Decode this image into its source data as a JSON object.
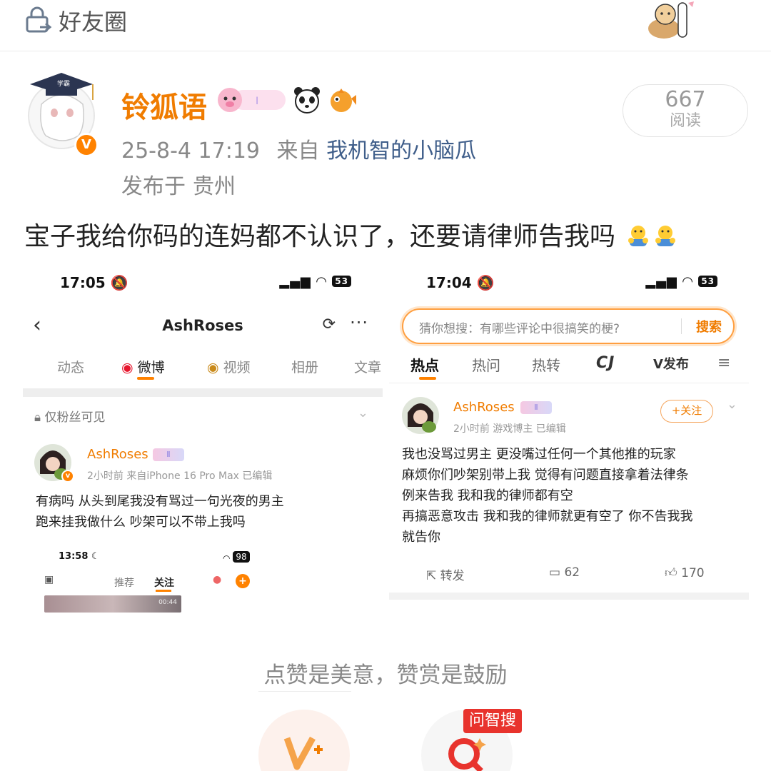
{
  "topbar": {
    "title": "好友圈"
  },
  "post": {
    "author": "铃狐语",
    "verified": "V",
    "date": "25-8-4 17:19",
    "from_prefix": "来自",
    "source": "我机智的小脑瓜",
    "published_prefix": "发布于",
    "location": "贵州",
    "reads": {
      "count": "667",
      "label": "阅读"
    },
    "text": "宝子我给你码的连妈都不认识了，还要请律师告我吗"
  },
  "shot_left": {
    "time": "17:05",
    "battery": "53",
    "title": "AshRoses",
    "tabs": [
      "动态",
      "微博",
      "视频",
      "相册",
      "文章"
    ],
    "visibility": "仅粉丝可见",
    "user": "AshRoses",
    "meta": "2小时前  来自iPhone 16 Pro Max  已编辑",
    "lines": [
      "有病吗 从头到尾我没有骂过一句光夜的男主",
      "跑来挂我做什么 吵架可以不带上我吗"
    ],
    "mini": {
      "time": "13:58",
      "battery": "98",
      "tab1": "推荐",
      "tab2": "关注",
      "plus": "+",
      "duration": "00:44"
    }
  },
  "shot_right": {
    "time": "17:04",
    "battery": "53",
    "search_placeholder": "猜你想搜：有哪些评论中很搞笑的梗?",
    "search_button": "搜索",
    "tabs": [
      "热点",
      "热问",
      "热转",
      "CJ",
      "V发布"
    ],
    "menu": "≡",
    "user": "AshRoses",
    "meta": "2小时前  游戏博主  已编辑",
    "follow": "+关注",
    "lines": [
      "我也没骂过男主 更没嘴过任何一个其他推的玩家",
      "麻烦你们吵架别带上我 觉得有问题直接拿着法律条",
      "例来告我 我和我的律师都有空",
      "再搞恶意攻击 我和我的律师就更有空了 你不告我我",
      "就告你"
    ],
    "repost": "转发",
    "comments": "62",
    "likes": "170"
  },
  "reward": {
    "slogan": "点赞是美意，赞赏是鼓励",
    "ai_badge": "问智搜"
  }
}
